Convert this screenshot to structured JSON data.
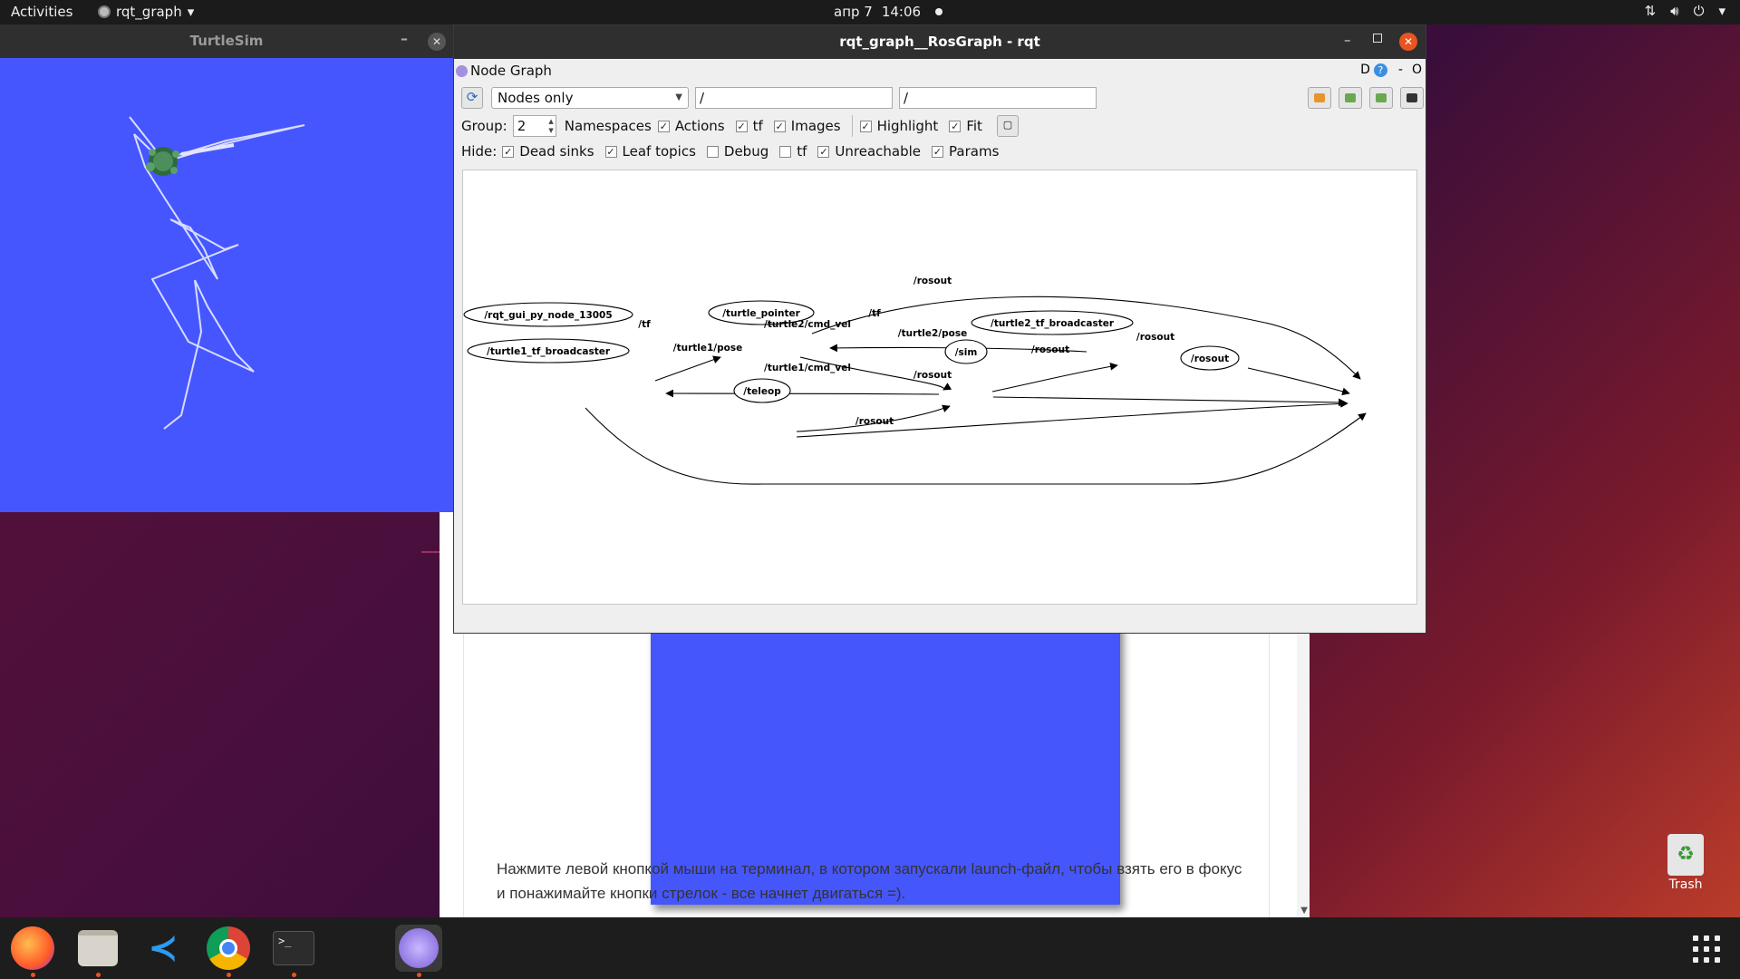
{
  "topbar": {
    "activities": "Activities",
    "app_name": "rqt_graph",
    "date": "апр 7",
    "time": "14:06"
  },
  "turtlesim": {
    "title": "TurtleSim",
    "minimize": "–",
    "close": "✕",
    "background_color": "#4556ff"
  },
  "rqt": {
    "title": "rqt_graph__RosGraph - rqt",
    "plugin_title": "Node Graph",
    "plugin_controls": "D",
    "help": "?",
    "dash": "-",
    "close_plugin": "O",
    "mode": "Nodes only",
    "node_filter": "/",
    "topic_filter": "/",
    "group_label": "Group:",
    "group_value": "2",
    "options": [
      {
        "label": "Namespaces",
        "checked": true
      },
      {
        "label": "Actions",
        "checked": true
      },
      {
        "label": "tf",
        "checked": true
      },
      {
        "label": "Images",
        "checked": true
      },
      {
        "label": "Highlight",
        "checked": true
      },
      {
        "label": "Fit",
        "checked": true
      }
    ],
    "hide_label": "Hide:",
    "hide_options": [
      {
        "label": "Dead sinks",
        "checked": true
      },
      {
        "label": "Leaf topics",
        "checked": true
      },
      {
        "label": "Debug",
        "checked": false
      },
      {
        "label": "tf",
        "checked": false
      },
      {
        "label": "Unreachable",
        "checked": true
      },
      {
        "label": "Params",
        "checked": true
      }
    ],
    "check_mark": "✓"
  },
  "graph": {
    "nodes": {
      "rqt_gui": "/rqt_gui_py_node_13005",
      "turtle1_tf": "/turtle1_tf_broadcaster",
      "turtle_pointer": "/turtle_pointer",
      "teleop": "/teleop",
      "sim": "/sim",
      "turtle2_tf": "/turtle2_tf_broadcaster",
      "rosout": "/rosout"
    },
    "edges": {
      "rosout_top": "/rosout",
      "tf_1": "/tf",
      "tf_2": "/tf",
      "turtle2_cmd_vel": "/turtle2/cmd_vel",
      "turtle2_pose": "/turtle2/pose",
      "turtle1_pose": "/turtle1/pose",
      "rosout_sim": "/rosout",
      "rosout_t2": "/rosout",
      "turtle1_cmd_vel": "/turtle1/cmd_vel",
      "rosout_teleop": "/rosout",
      "rosout_bottom": "/rosout"
    }
  },
  "article": {
    "text": "Нажмите левой кнопкой мыши на терминал, в котором запускали launch-файл, чтобы взять его в фокус и понажимайте кнопки стрелок - все начнет двигаться =)."
  },
  "desktop": {
    "trash_label": "Trash"
  },
  "dock": {
    "items": [
      "firefox-icon",
      "files-icon",
      "vscode-icon",
      "chrome-icon",
      "terminal-icon",
      "rqt-icon"
    ]
  },
  "colors": {
    "accent": "#e95420",
    "turtle_bg": "#4556ff"
  }
}
